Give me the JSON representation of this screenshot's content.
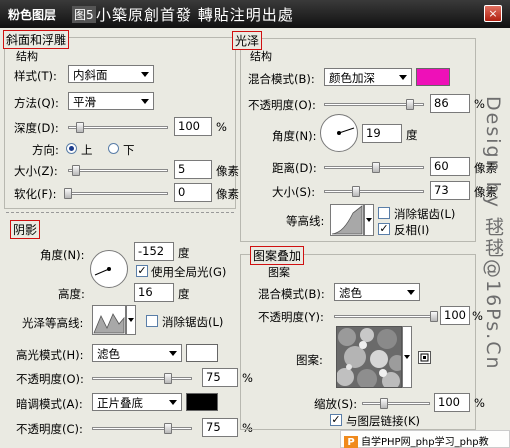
{
  "titlebar": {
    "title": "粉色图层",
    "title_suffix": "图5",
    "watermark": "小築原創首發 轉貼注明出處",
    "close": "×"
  },
  "bevel": {
    "title": "斜面和浮雕",
    "subtitle": "结构",
    "style_label": "样式(T):",
    "style_value": "内斜面",
    "method_label": "方法(Q):",
    "method_value": "平滑",
    "depth_label": "深度(D):",
    "depth_value": "100",
    "depth_unit": "%",
    "depth_level": 0.1,
    "direction_label": "方向:",
    "dir_up": "上",
    "dir_down": "下",
    "size_label": "大小(Z):",
    "size_value": "5",
    "size_unit": "像素",
    "soften_label": "软化(F):",
    "soften_value": "0",
    "soften_unit": "像素"
  },
  "shading": {
    "title": "阴影",
    "angle_label": "角度(N):",
    "angle_value": "-152",
    "angle_unit": "度",
    "global_light_label": "使用全局光(G)",
    "altitude_label": "高度:",
    "altitude_value": "16",
    "altitude_unit": "度",
    "gloss_contour_label": "光泽等高线:",
    "antialias_label": "消除锯齿(L)",
    "highlight_mode_label": "高光模式(H):",
    "highlight_mode_value": "滤色",
    "highlight_color": "#ffffff",
    "highlight_opacity_label": "不透明度(O):",
    "highlight_opacity_value": "75",
    "highlight_opacity_unit": "%",
    "shadow_mode_label": "暗调模式(A):",
    "shadow_mode_value": "正片叠底",
    "shadow_color": "#000000",
    "shadow_opacity_label": "不透明度(C):",
    "shadow_opacity_value": "75",
    "shadow_opacity_unit": "%"
  },
  "satin": {
    "title": "光泽",
    "subtitle": "结构",
    "blend_label": "混合模式(B):",
    "blend_value": "颜色加深",
    "color": "#ee10b8",
    "opacity_label": "不透明度(O):",
    "opacity_value": "86",
    "opacity_unit": "%",
    "angle_label": "角度(N):",
    "angle_value": "19",
    "angle_unit": "度",
    "distance_label": "距离(D):",
    "distance_value": "60",
    "distance_unit": "像素",
    "size_label": "大小(S):",
    "size_value": "73",
    "size_unit": "像素",
    "contour_label": "等高线:",
    "antialias_label": "消除锯齿(L)",
    "invert_label": "反相(I)"
  },
  "pattern": {
    "title": "图案叠加",
    "subtitle": "图案",
    "blend_label": "混合模式(B):",
    "blend_value": "滤色",
    "opacity_label": "不透明度(Y):",
    "opacity_value": "100",
    "opacity_unit": "%",
    "pattern_label": "图案:",
    "scale_label": "缩放(S):",
    "scale_value": "100",
    "scale_unit": "%",
    "link_label": "与图层链接(K)"
  },
  "watermarks": {
    "side": "Design by 毬毬@16Ps.Cn",
    "footer": "自学PHP网_php学习_php教"
  }
}
